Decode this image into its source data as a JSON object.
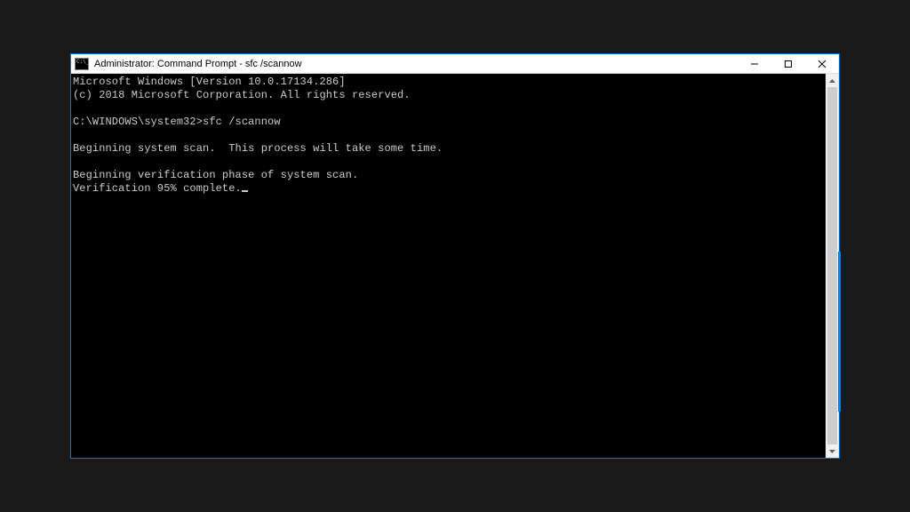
{
  "titlebar": {
    "title": "Administrator: Command Prompt - sfc  /scannow"
  },
  "terminal": {
    "line1": "Microsoft Windows [Version 10.0.17134.286]",
    "line2": "(c) 2018 Microsoft Corporation. All rights reserved.",
    "blank1": "",
    "prompt": "C:\\WINDOWS\\system32>sfc /scannow",
    "blank2": "",
    "line5": "Beginning system scan.  This process will take some time.",
    "blank3": "",
    "line7": "Beginning verification phase of system scan.",
    "line8": "Verification 95% complete."
  }
}
